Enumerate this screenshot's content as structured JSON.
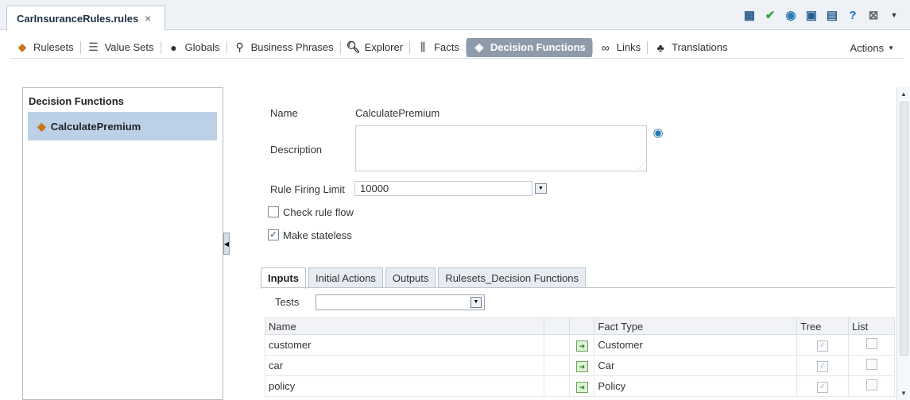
{
  "file_tab": {
    "label": "CarInsuranceRules.rules",
    "close": "×"
  },
  "toolbar": {
    "items": [
      {
        "label": "Rulesets",
        "icon": "ruleset-icon"
      },
      {
        "label": "Value Sets",
        "icon": "valuesets-icon"
      },
      {
        "label": "Globals",
        "icon": "globe-icon"
      },
      {
        "label": "Business Phrases",
        "icon": "phrases-icon"
      },
      {
        "label": "Explorer",
        "icon": "search-icon"
      },
      {
        "label": "Facts",
        "icon": "facts-icon"
      },
      {
        "label": "Decision Functions",
        "icon": "decision-function-icon"
      },
      {
        "label": "Links",
        "icon": "link-icon"
      },
      {
        "label": "Translations",
        "icon": "translations-icon"
      }
    ],
    "actions_label": "Actions"
  },
  "left_panel": {
    "title": "Decision Functions",
    "item": "CalculatePremium"
  },
  "form": {
    "name_label": "Name",
    "name_value": "CalculatePremium",
    "description_label": "Description",
    "rule_firing_limit_label": "Rule Firing Limit",
    "rule_firing_limit_value": "10000",
    "check_rule_flow_label": "Check rule flow",
    "check_rule_flow_checked": false,
    "make_stateless_label": "Make stateless",
    "make_stateless_checked": true
  },
  "tabs": [
    {
      "label": "Inputs",
      "active": true
    },
    {
      "label": "Initial Actions",
      "active": false
    },
    {
      "label": "Outputs",
      "active": false
    },
    {
      "label": "Rulesets_Decision Functions",
      "active": false
    }
  ],
  "tests_label": "Tests",
  "table": {
    "headers": [
      "Name",
      "",
      "",
      "Fact Type",
      "Tree",
      "List"
    ],
    "rows": [
      {
        "name": "customer",
        "fact_type": "Customer",
        "tree": true,
        "list": false
      },
      {
        "name": "car",
        "fact_type": "Car",
        "tree": true,
        "list": false
      },
      {
        "name": "policy",
        "fact_type": "Policy",
        "tree": true,
        "list": false
      }
    ]
  }
}
